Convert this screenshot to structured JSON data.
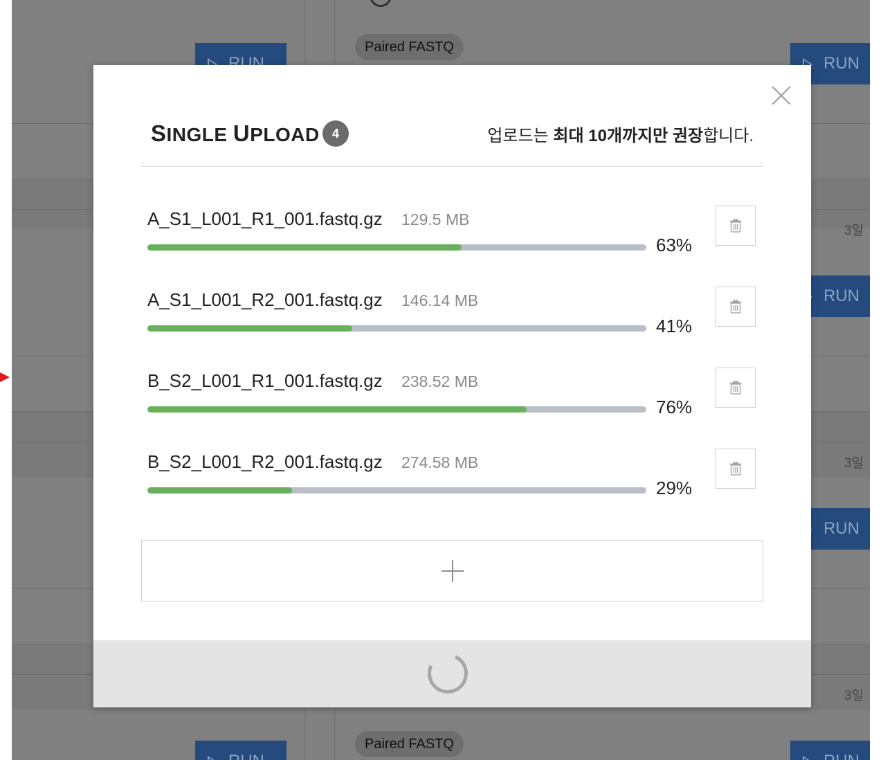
{
  "background": {
    "run_label": "RUN",
    "pill_label": "Paired FASTQ",
    "date_fragment": "3일"
  },
  "modal": {
    "title_parts": [
      "S",
      "INGLE ",
      "U",
      "PLOAD"
    ],
    "file_count": "4",
    "notice": {
      "prefix": "업로드는 ",
      "bold": "최대 10개까지만 권장",
      "suffix": "합니다."
    },
    "files": [
      {
        "name": "A_S1_L001_R1_001.fastq.gz",
        "size": "129.5 MB",
        "progress": 63,
        "progress_label": "63%"
      },
      {
        "name": "A_S1_L001_R2_001.fastq.gz",
        "size": "146.14 MB",
        "progress": 41,
        "progress_label": "41%"
      },
      {
        "name": "B_S2_L001_R1_001.fastq.gz",
        "size": "238.52 MB",
        "progress": 76,
        "progress_label": "76%"
      },
      {
        "name": "B_S2_L001_R2_001.fastq.gz",
        "size": "274.58 MB",
        "progress": 29,
        "progress_label": "29%"
      }
    ],
    "icons": {
      "close": "close-icon",
      "delete": "trash-icon",
      "add": "plus-icon",
      "loading": "spinner-icon"
    },
    "colors": {
      "progress_fill": "#6ab05c",
      "progress_track": "#b8bfc6",
      "run_button": "#244a7e",
      "badge": "#6b6b6b"
    }
  }
}
